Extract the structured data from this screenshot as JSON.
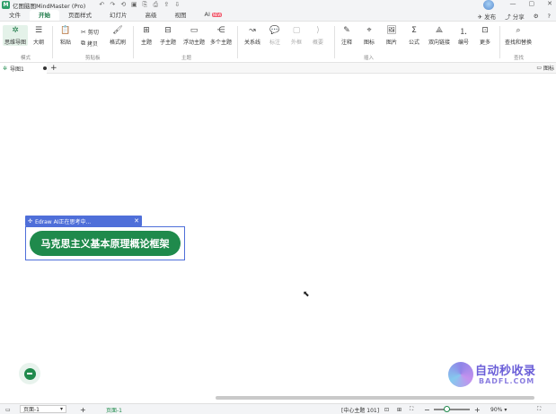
{
  "titlebar": {
    "logo": "M",
    "title": "亿图脑图MindMaster (Pro)",
    "quick_actions": [
      "↶",
      "↷",
      "⟲",
      "▣",
      "⎘",
      "⎙",
      "⇪",
      "⇩"
    ],
    "window_controls": [
      "—",
      "▢",
      "✕"
    ]
  },
  "menubar": {
    "tabs": [
      "文件",
      "开始",
      "页面样式",
      "幻灯片",
      "高级",
      "视图",
      "AI"
    ],
    "active_index": 1,
    "ai_badge": "NEW",
    "right": {
      "publish": "发布",
      "share": "分享",
      "settings": "⚙",
      "help": "?"
    }
  },
  "ribbon": {
    "mode": {
      "mindmap": "思维导图",
      "outline": "大纲",
      "group": "模式"
    },
    "clipboard": {
      "paste": "粘贴",
      "cut": "剪切",
      "copy": "拷贝",
      "format_painter": "格式刷",
      "group": "剪贴板"
    },
    "topic": {
      "topic": "主题",
      "subtopic": "子主题",
      "floating": "浮动主题",
      "multiple": "多个主题",
      "group": "主题"
    },
    "relation": {
      "relation": "关系线",
      "callout": "标注",
      "boundary": "外框",
      "summary": "概要"
    },
    "insert": {
      "note": "注释",
      "icon": "图标",
      "image": "图片",
      "formula": "公式",
      "bilink": "双向链接",
      "numbering": "编号",
      "more": "更多",
      "group": "插入"
    },
    "find": {
      "find_replace": "查找和替换",
      "group": "查找"
    }
  },
  "doctabs": {
    "tab_label": "导图1",
    "add": "+",
    "side_panel": "图标"
  },
  "canvas": {
    "ai_banner": "Edraw AI正在思考中...",
    "ai_banner_close": "✕",
    "central_topic": "马克思主义基本原理概论框架",
    "watermark_main": "自动秒收录",
    "watermark_sub": "BADFL.COM"
  },
  "statusbar": {
    "page_select": "页面-1",
    "add_page": "+",
    "page_tab": "页面-1",
    "center_info": "[中心主题 101]",
    "zoom_out": "−",
    "zoom_in": "+",
    "zoom_level": "90%",
    "zoom_fraction": 0.35
  },
  "colors": {
    "accent": "#1f8a4c",
    "ai_blue": "#4f6fd9"
  }
}
